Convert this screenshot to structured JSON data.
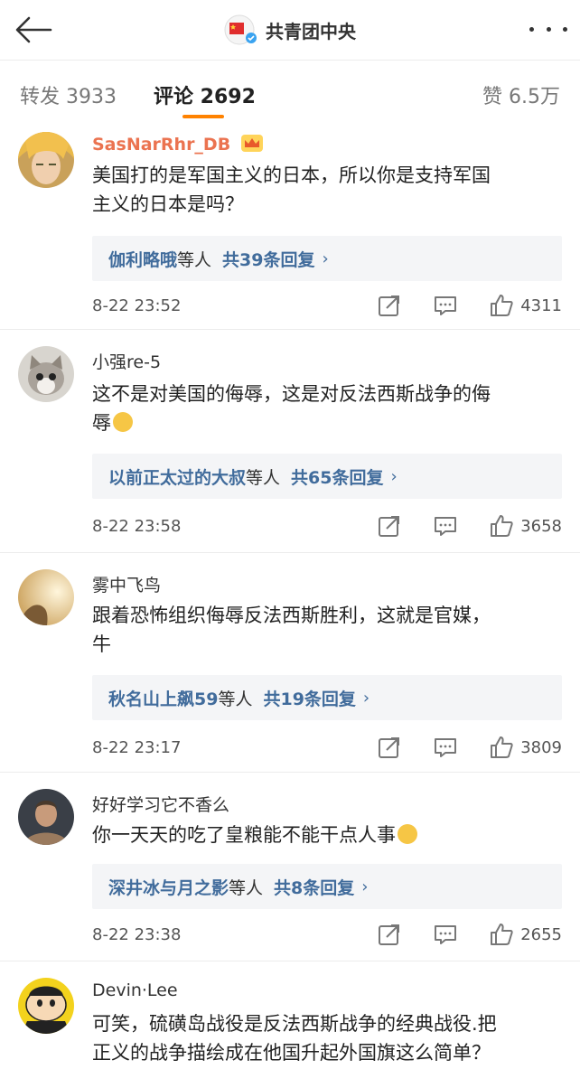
{
  "header": {
    "title": "共青团中央"
  },
  "tabs": {
    "repost": "转发 3933",
    "comment": "评论 2692",
    "like": "赞 6.5万"
  },
  "comments": [
    {
      "user": "SasNarRhr_DB",
      "text_line1": "美国打的是军国主义的日本，所以你是支持军国",
      "text_line2": "主义的日本是吗？",
      "reply_who": "伽利略哦",
      "reply_etc": "等人",
      "reply_count": "共39条回复",
      "time": "8-22 23:52",
      "likes": "4311"
    },
    {
      "user": "小强re-5",
      "text_line1": "这不是对美国的侮辱，这是对反法西斯战争的侮",
      "text_line2": "辱",
      "reply_who": "以前正太过的大叔",
      "reply_etc": "等人",
      "reply_count": "共65条回复",
      "time": "8-22 23:58",
      "likes": "3658"
    },
    {
      "user": "雾中飞鸟",
      "text_line1": "跟着恐怖组织侮辱反法西斯胜利，这就是官媒，",
      "text_line2": "牛",
      "reply_who": "秋名山上飙59",
      "reply_etc": "等人",
      "reply_count": "共19条回复",
      "time": "8-22 23:17",
      "likes": "3809"
    },
    {
      "user": "好好学习它不香么",
      "text_line1": "你一天天的吃了皇粮能不能干点人事",
      "reply_who": "深井冰与月之影",
      "reply_etc": "等人",
      "reply_count": "共8条回复",
      "time": "8-22 23:38",
      "likes": "2655"
    },
    {
      "user": "Devin·Lee",
      "text_line1": "可笑，硫磺岛战役是反法西斯战争的经典战役.把",
      "text_line2": "正义的战争描绘成在他国升起外国旗这么简单？"
    }
  ],
  "icons": {
    "back": "back-arrow-icon",
    "more": "more-dots-icon",
    "repost": "repost-icon",
    "comment": "comment-icon",
    "like": "thumbs-up-icon",
    "vip": "crown-badge-icon"
  },
  "colors": {
    "accent": "#ff8200",
    "link": "#416c9c",
    "vip_name": "#eb7350"
  }
}
